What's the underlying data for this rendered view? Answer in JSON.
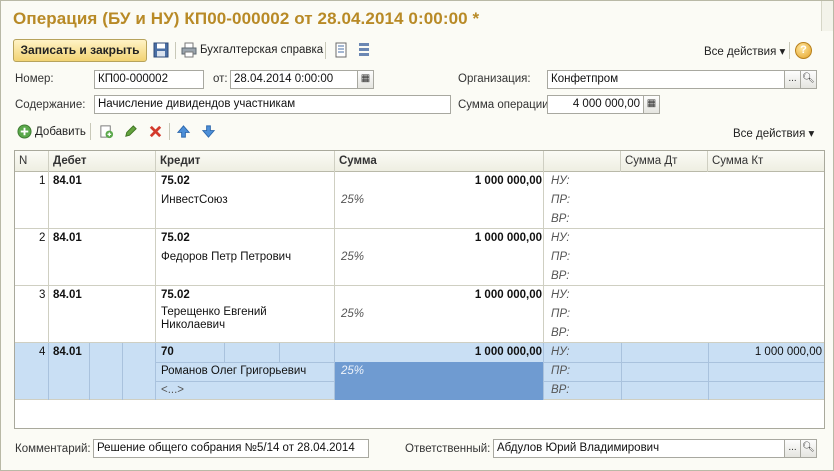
{
  "window": {
    "title": "Операция (БУ и НУ) КП00-000002 от 28.04.2014 0:00:00 *"
  },
  "toolbar": {
    "save_close_label": "Записать и закрыть",
    "accounting_ref_label": "Бухгалтерская справка",
    "all_actions_label": "Все действия",
    "help_label": "?"
  },
  "form": {
    "number_label": "Номер:",
    "number_value": "КП00-000002",
    "date_label": "от:",
    "date_value": "28.04.2014  0:00:00",
    "org_label": "Организация:",
    "org_value": "Конфетпром",
    "content_label": "Содержание:",
    "content_value": "Начисление дивидендов участникам",
    "sum_label": "Сумма операции:",
    "sum_value": "4 000 000,00"
  },
  "table_toolbar": {
    "add_label": "Добавить",
    "all_actions_label": "Все действия"
  },
  "grid": {
    "headers": {
      "n": "N",
      "debit": "Дебет",
      "credit": "Кредит",
      "sum": "Сумма",
      "sum_dt": "Сумма Дт",
      "sum_kt": "Сумма Кт"
    },
    "tax_labels": {
      "nu": "НУ:",
      "pr": "ПР:",
      "vr": "ВР:"
    },
    "rows": [
      {
        "n": "1",
        "debit": "84.01",
        "credit": "75.02",
        "credit_sub": "ИнвестСоюз",
        "sum": "1 000 000,00",
        "pct": "25%"
      },
      {
        "n": "2",
        "debit": "84.01",
        "credit": "75.02",
        "credit_sub": "Федоров Петр Петрович",
        "sum": "1 000 000,00",
        "pct": "25%"
      },
      {
        "n": "3",
        "debit": "84.01",
        "credit": "75.02",
        "credit_sub": "Терещенко Евгений Николаевич",
        "sum": "1 000 000,00",
        "pct": "25%"
      },
      {
        "n": "4",
        "debit": "84.01",
        "credit": "70",
        "credit_sub": "Романов Олег Григорьевич",
        "credit_sub2": "<...>",
        "sum": "1 000 000,00",
        "pct": "25%",
        "sum_kt": "1 000 000,00"
      }
    ]
  },
  "footer": {
    "comment_label": "Комментарий:",
    "comment_value": "Решение общего собрания №5/14 от 28.04.2014",
    "responsible_label": "Ответственный:",
    "responsible_value": "Абдулов Юрий Владимирович"
  },
  "colors": {
    "title": "#b88a26",
    "selected_row": "#c9dff4",
    "selected_cell": "#6f9bd1"
  }
}
